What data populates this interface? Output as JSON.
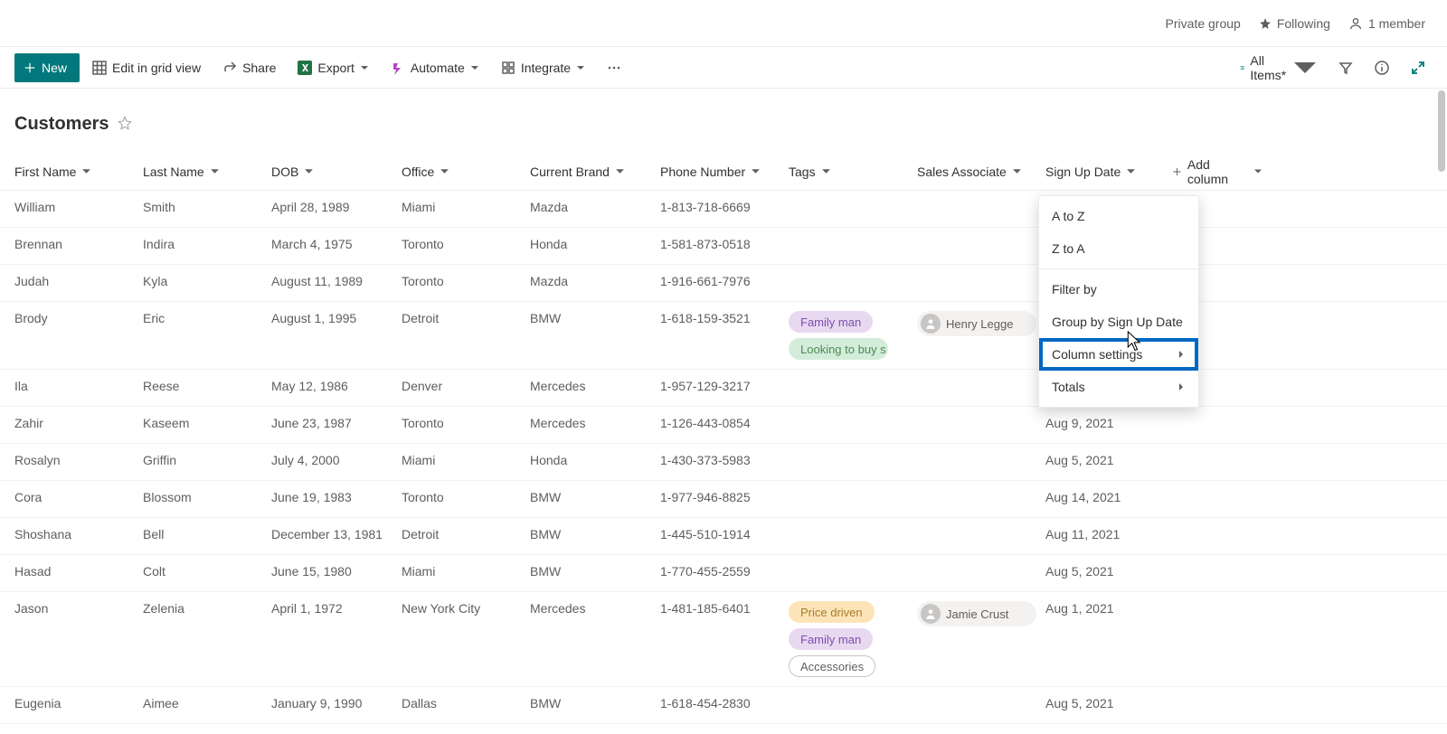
{
  "header": {
    "group_type": "Private group",
    "following_label": "Following",
    "member_count_label": "1 member"
  },
  "toolbar": {
    "new_label": "New",
    "edit_grid_label": "Edit in grid view",
    "share_label": "Share",
    "export_label": "Export",
    "automate_label": "Automate",
    "integrate_label": "Integrate",
    "view_label": "All Items*"
  },
  "list": {
    "title": "Customers"
  },
  "columns": {
    "firstname": "First Name",
    "lastname": "Last Name",
    "dob": "DOB",
    "office": "Office",
    "brand": "Current Brand",
    "phone": "Phone Number",
    "tags": "Tags",
    "sales": "Sales Associate",
    "signup": "Sign Up Date",
    "add": "Add column"
  },
  "menu": {
    "a_to_z": "A to Z",
    "z_to_a": "Z to A",
    "filter_by": "Filter by",
    "group_by": "Group by Sign Up Date",
    "column_settings": "Column settings",
    "totals": "Totals"
  },
  "rows": [
    {
      "firstname": "William",
      "lastname": "Smith",
      "dob": "April 28, 1989",
      "office": "Miami",
      "brand": "Mazda",
      "phone": "1-813-718-6669",
      "tags": [],
      "sales": "",
      "signup": ""
    },
    {
      "firstname": "Brennan",
      "lastname": "Indira",
      "dob": "March 4, 1975",
      "office": "Toronto",
      "brand": "Honda",
      "phone": "1-581-873-0518",
      "tags": [],
      "sales": "",
      "signup": ""
    },
    {
      "firstname": "Judah",
      "lastname": "Kyla",
      "dob": "August 11, 1989",
      "office": "Toronto",
      "brand": "Mazda",
      "phone": "1-916-661-7976",
      "tags": [],
      "sales": "",
      "signup": ""
    },
    {
      "firstname": "Brody",
      "lastname": "Eric",
      "dob": "August 1, 1995",
      "office": "Detroit",
      "brand": "BMW",
      "phone": "1-618-159-3521",
      "tags": [
        {
          "text": "Family man",
          "cls": "tag-family"
        },
        {
          "text": "Looking to buy s...",
          "cls": "tag-looking"
        }
      ],
      "sales": "Henry Legge",
      "signup": ""
    },
    {
      "firstname": "Ila",
      "lastname": "Reese",
      "dob": "May 12, 1986",
      "office": "Denver",
      "brand": "Mercedes",
      "phone": "1-957-129-3217",
      "tags": [],
      "sales": "",
      "signup": ""
    },
    {
      "firstname": "Zahir",
      "lastname": "Kaseem",
      "dob": "June 23, 1987",
      "office": "Toronto",
      "brand": "Mercedes",
      "phone": "1-126-443-0854",
      "tags": [],
      "sales": "",
      "signup": "Aug 9, 2021"
    },
    {
      "firstname": "Rosalyn",
      "lastname": "Griffin",
      "dob": "July 4, 2000",
      "office": "Miami",
      "brand": "Honda",
      "phone": "1-430-373-5983",
      "tags": [],
      "sales": "",
      "signup": "Aug 5, 2021"
    },
    {
      "firstname": "Cora",
      "lastname": "Blossom",
      "dob": "June 19, 1983",
      "office": "Toronto",
      "brand": "BMW",
      "phone": "1-977-946-8825",
      "tags": [],
      "sales": "",
      "signup": "Aug 14, 2021"
    },
    {
      "firstname": "Shoshana",
      "lastname": "Bell",
      "dob": "December 13, 1981",
      "office": "Detroit",
      "brand": "BMW",
      "phone": "1-445-510-1914",
      "tags": [],
      "sales": "",
      "signup": "Aug 11, 2021"
    },
    {
      "firstname": "Hasad",
      "lastname": "Colt",
      "dob": "June 15, 1980",
      "office": "Miami",
      "brand": "BMW",
      "phone": "1-770-455-2559",
      "tags": [],
      "sales": "",
      "signup": "Aug 5, 2021"
    },
    {
      "firstname": "Jason",
      "lastname": "Zelenia",
      "dob": "April 1, 1972",
      "office": "New York City",
      "brand": "Mercedes",
      "phone": "1-481-185-6401",
      "tags": [
        {
          "text": "Price driven",
          "cls": "tag-price"
        },
        {
          "text": "Family man",
          "cls": "tag-family"
        },
        {
          "text": "Accessories",
          "cls": "tag-access"
        }
      ],
      "sales": "Jamie Crust",
      "signup": "Aug 1, 2021"
    },
    {
      "firstname": "Eugenia",
      "lastname": "Aimee",
      "dob": "January 9, 1990",
      "office": "Dallas",
      "brand": "BMW",
      "phone": "1-618-454-2830",
      "tags": [],
      "sales": "",
      "signup": "Aug 5, 2021"
    }
  ]
}
